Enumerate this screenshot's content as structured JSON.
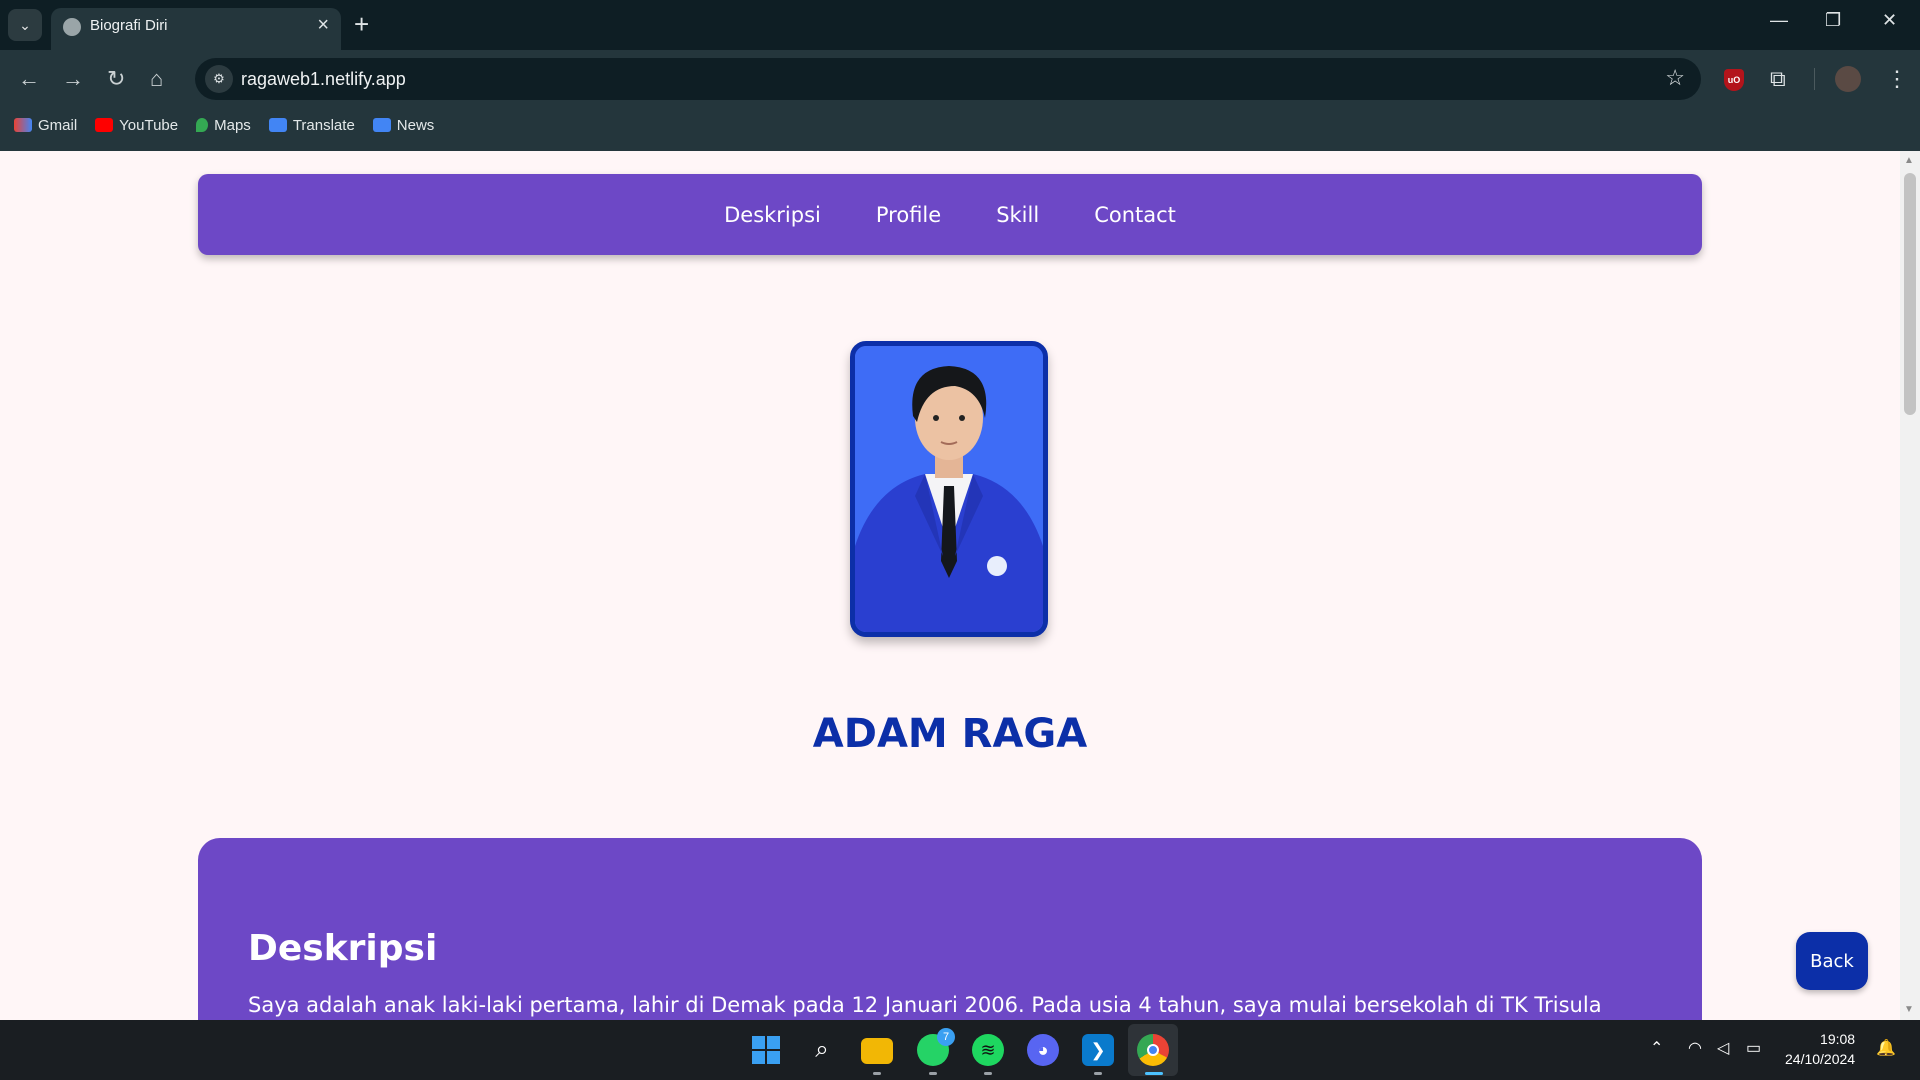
{
  "browser": {
    "tab_title": "Biografi Diri",
    "url": "ragaweb1.netlify.app",
    "bookmarks": [
      "Gmail",
      "YouTube",
      "Maps",
      "Translate",
      "News"
    ]
  },
  "site": {
    "nav": [
      "Deskripsi",
      "Profile",
      "Skill",
      "Contact"
    ],
    "name": "ADAM RAGA",
    "description_heading": "Deskripsi",
    "description_text": "Saya adalah anak laki-laki pertama, lahir di Demak pada 12 Januari 2006. Pada usia 4 tahun, saya mulai bersekolah di TK Trisula Pamekar",
    "back_label": "Back"
  },
  "taskbar": {
    "whatsapp_badge": "7",
    "time": "19:08",
    "date": "24/10/2024"
  },
  "colors": {
    "accent_purple": "#6d48c6",
    "accent_blue": "#0c2fa8",
    "page_bg": "#fff6f7"
  }
}
